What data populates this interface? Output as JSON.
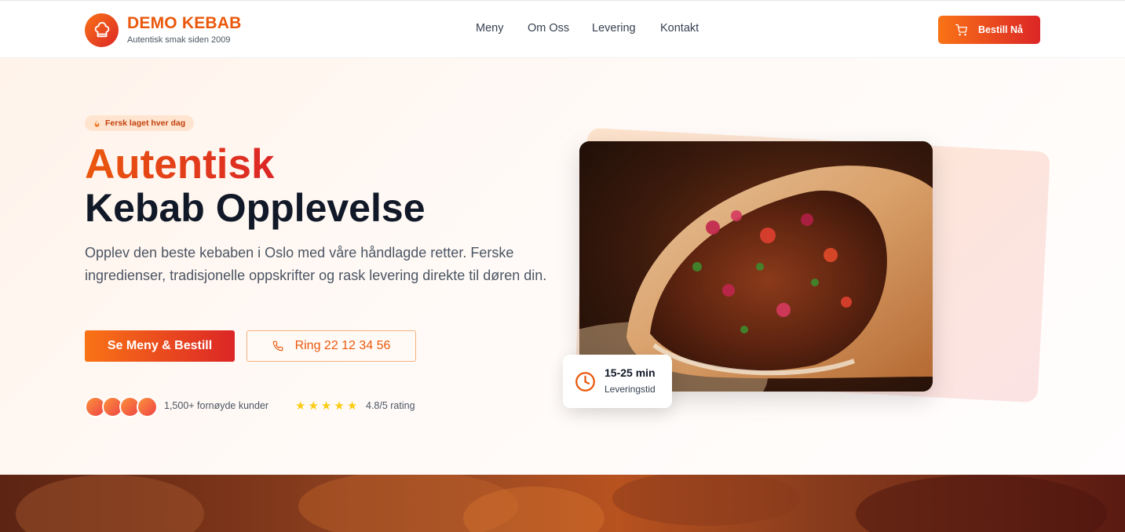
{
  "header": {
    "brand_name": "DEMO KEBAB",
    "brand_tagline": "Autentisk smak siden 2009",
    "nav": [
      "Meny",
      "Om Oss",
      "Levering",
      "Kontakt"
    ],
    "order_label": "Bestill Nå",
    "logo_icon": "chef-hat-icon",
    "order_icon": "cart-icon"
  },
  "hero": {
    "badge_text": "Fersk laget hver dag",
    "badge_icon": "flame-icon",
    "title_line1": "Autentisk",
    "title_line2": "Kebab Opplevelse",
    "description": "Opplev den beste kebaben i Oslo med våre håndlagde retter. Ferske ingredienser, tradisjonelle oppskrifter og rask levering direkte til døren din.",
    "cta_primary": "Se Meny & Bestill",
    "cta_secondary": "Ring 22 12 34 56",
    "cta_secondary_icon": "phone-icon",
    "customers_text": "1,500+ fornøyde kunder",
    "stars": 5,
    "rating_text": "4.8/5 rating",
    "delivery_time": "15-25 min",
    "delivery_label": "Leveringstid",
    "delivery_icon": "clock-icon"
  },
  "colors": {
    "accent_orange": "#f97316",
    "accent_red": "#dc2626",
    "dark_text": "#111827",
    "star": "#facc15"
  }
}
